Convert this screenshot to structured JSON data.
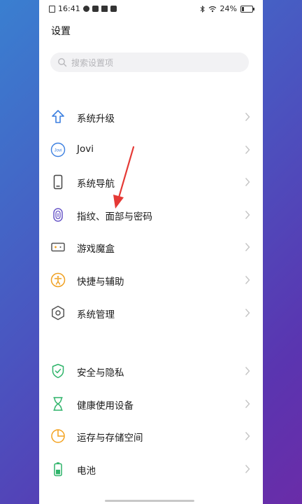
{
  "status_bar": {
    "time": "16:41",
    "battery": "24%",
    "battery_level": 0.24
  },
  "page_title": "设置",
  "search": {
    "placeholder": "搜索设置项"
  },
  "settings": {
    "items": [
      {
        "label": "系统升级",
        "icon": "upgrade-icon"
      },
      {
        "label": "Jovi",
        "icon": "jovi-icon"
      },
      {
        "label": "系统导航",
        "icon": "phone-navigation-icon"
      },
      {
        "label": "指纹、面部与密码",
        "icon": "fingerprint-icon"
      },
      {
        "label": "游戏魔盒",
        "icon": "game-box-icon"
      },
      {
        "label": "快捷与辅助",
        "icon": "accessibility-icon"
      },
      {
        "label": "系统管理",
        "icon": "hexagon-settings-icon"
      },
      {
        "label": "安全与隐私",
        "icon": "shield-check-icon"
      },
      {
        "label": "健康使用设备",
        "icon": "hourglass-icon"
      },
      {
        "label": "运存与存储空间",
        "icon": "storage-pie-icon"
      },
      {
        "label": "电池",
        "icon": "battery-icon"
      }
    ]
  },
  "colors": {
    "accent_blue": "#3b7fe0",
    "shield_green": "#2fb46a",
    "storage_orange": "#f4a21e",
    "arrow_red": "#e53935"
  }
}
